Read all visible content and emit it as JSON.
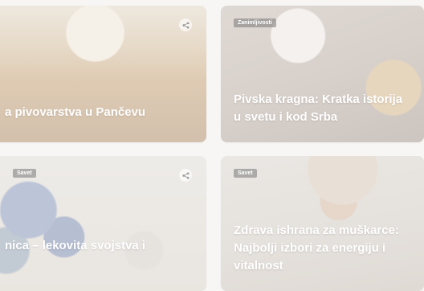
{
  "cards": [
    {
      "category": "",
      "title": "a pivovarstva u Pančevu",
      "show_share": true
    },
    {
      "category": "Zanimljivosti",
      "title": "Pivska kragna: Kratka istorija u svetu i kod Srba",
      "show_share": false
    },
    {
      "category": "Savet",
      "title": "nica – lekovita svojstva i",
      "show_share": true
    },
    {
      "category": "Savet",
      "title": "Zdrava ishrana za muškarce: Najbolji izbori za energiju i vitalnost",
      "show_share": false
    }
  ]
}
